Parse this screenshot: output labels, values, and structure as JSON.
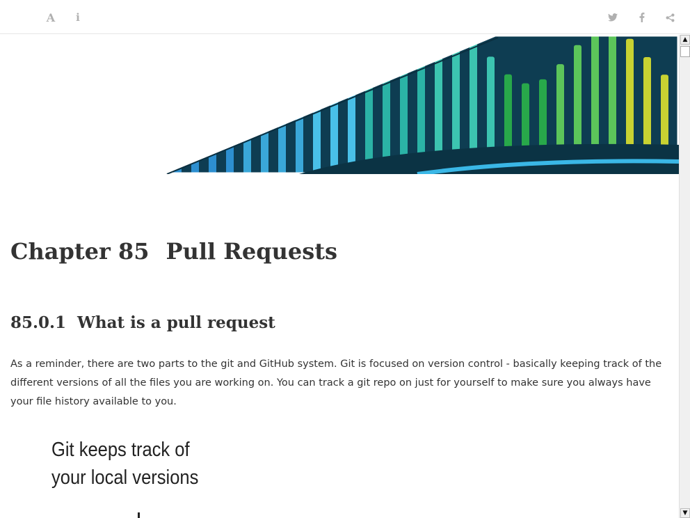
{
  "toolbar": {
    "font_icon": "A",
    "info_icon": "i",
    "icons": [
      "font-settings-icon",
      "info-icon",
      "twitter-icon",
      "facebook-icon",
      "share-icon"
    ],
    "icon_color": "#b0b0b0"
  },
  "chapter": {
    "number": "Chapter 85",
    "title": "Pull Requests"
  },
  "section": {
    "number": "85.0.1",
    "title": "What is a pull request"
  },
  "body": {
    "paragraph": "As a reminder, there are two parts to the git and GitHub system. Git is focused on version control - basically keeping track of the different versions of all the files you are working on. You can track a git repo on just for yourself to make sure you always have your file history available to you."
  },
  "figure": {
    "line1": "Git keeps track of",
    "line2": "your local versions"
  },
  "scrollbar": {
    "up_arrow": "▲",
    "down_arrow": "▼"
  },
  "colors": {
    "banner_dark": "#0e3d52",
    "banner_blue": "#3aa7d8",
    "banner_teal": "#2bb3a6",
    "banner_green": "#28a84a",
    "banner_yellow": "#c8d232",
    "text": "#333333"
  }
}
